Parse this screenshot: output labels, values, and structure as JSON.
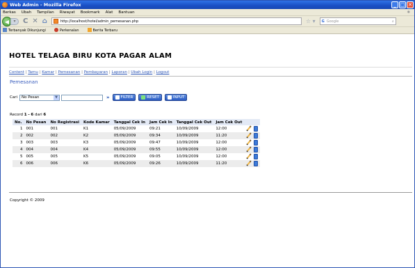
{
  "window": {
    "title": "Web Admin - Mozilla Firefox",
    "buttons": {
      "minimize": "_",
      "maximize": "□",
      "close": "✕"
    }
  },
  "menu": [
    "Berkas",
    "Ubah",
    "Tampilan",
    "Riwayat",
    "Bookmark",
    "Alat",
    "Bantuan"
  ],
  "browser": {
    "url": "http://localhost/hotel/admin_pemesanan.php",
    "search_placeholder": "Google",
    "bookmarks": [
      "Terbanyak Dikunjungi",
      "Perkenalan",
      "Berita Terbaru"
    ]
  },
  "site": {
    "title": "HOTEL TELAGA BIRU KOTA PAGAR ALAM",
    "nav": [
      "Content",
      "Tamu",
      "Kamar",
      "Pemesanan",
      "Pembayaran",
      "Laporan",
      "Ubah Login",
      "Logout"
    ],
    "section": "Pemesanan"
  },
  "filter": {
    "label": "Cari",
    "select_value": "No Pesan",
    "text_value": "",
    "go_symbol": "»",
    "btn_filter": "FILTER",
    "btn_reset": "RESET",
    "btn_input": "INPUT"
  },
  "record": {
    "prefix": "Record",
    "from": "1",
    "dash": "-",
    "to": "6",
    "of_label": "dari",
    "total": "6"
  },
  "table": {
    "headers": [
      "No.",
      "No Pesan",
      "No Registrasi",
      "Kode Kamar",
      "Tanggal Cek In",
      "Jam Cek In",
      "Tanggal Cek Out",
      "Jam Cek Out"
    ],
    "rows": [
      [
        "1",
        "001",
        "001",
        "K1",
        "05/09/2009",
        "09:21",
        "10/09/2009",
        "12:00"
      ],
      [
        "2",
        "002",
        "002",
        "K2",
        "05/09/2009",
        "09:34",
        "10/09/2009",
        "11:20"
      ],
      [
        "3",
        "003",
        "003",
        "K3",
        "05/09/2009",
        "09:47",
        "10/09/2009",
        "12:00"
      ],
      [
        "4",
        "004",
        "004",
        "K4",
        "05/09/2009",
        "09:55",
        "10/09/2009",
        "12:00"
      ],
      [
        "5",
        "005",
        "005",
        "K5",
        "05/09/2009",
        "09:05",
        "10/09/2009",
        "12:00"
      ],
      [
        "6",
        "006",
        "006",
        "K6",
        "05/09/2009",
        "09:26",
        "10/09/2009",
        "11:20"
      ]
    ]
  },
  "footer": "Copyright © 2009"
}
